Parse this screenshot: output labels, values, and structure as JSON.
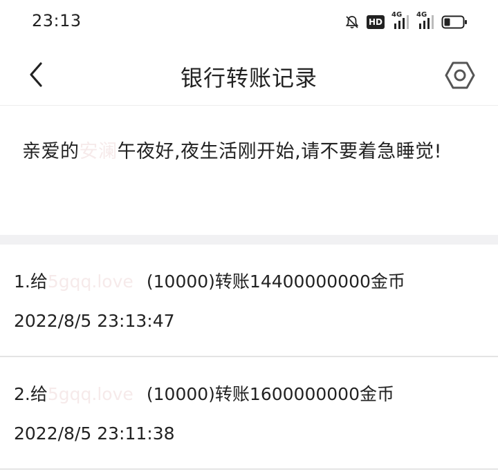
{
  "status_bar": {
    "time": "23:13",
    "hd_label": "HD",
    "network_1": "4G",
    "network_2": "4G"
  },
  "header": {
    "title": "银行转账记录"
  },
  "greeting": {
    "prefix": "亲爱的",
    "name": "安澜",
    "message": "午夜好,夜生活刚开始,请不要着急睡觉!"
  },
  "records": [
    {
      "index": "1.",
      "give_label": "给",
      "recipient": "5gqq.love",
      "detail": "(10000)转账14400000000金币",
      "timestamp": "2022/8/5 23:13:47"
    },
    {
      "index": "2.",
      "give_label": "给",
      "recipient": "5gqq.love",
      "detail": "(10000)转账1600000000金币",
      "timestamp": "2022/8/5 23:11:38"
    }
  ],
  "colors": {
    "text": "#222222",
    "faded_name": "#f6eaea",
    "divider": "#f1f1f3"
  }
}
